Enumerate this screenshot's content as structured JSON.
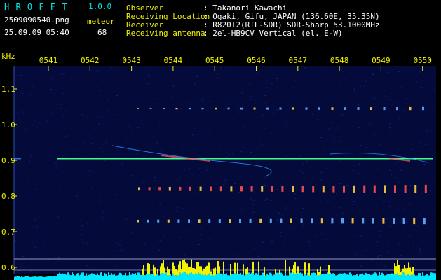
{
  "header": {
    "app_name": "H R O F F T",
    "version": "1.0.0",
    "filename": "2509090540.png",
    "datetime": "25.09.09 05:40",
    "meteor_label": "meteor",
    "meteor_count": "68",
    "info_labels": [
      "Observer",
      "Receiving Location",
      "Receiver",
      "Receiving antenna"
    ],
    "info_values": [
      ": Takanori Kawachi",
      ": Ogaki, Gifu, JAPAN (136.60E, 35.35N)",
      ": R820T2(RTL-SDR) SDR-Sharp 53.1000MHz",
      ": 2el-HB9CV Vertical (el. E-W)"
    ]
  },
  "spectrogram": {
    "y_unit": "kHz",
    "time_labels": [
      "0541",
      "0542",
      "0543",
      "0544",
      "0545",
      "0546",
      "0547",
      "0548",
      "0549",
      "0550"
    ],
    "freq_labels": [
      "1.1",
      "1.0",
      "0.9",
      "0.8",
      "0.7",
      "0.6"
    ],
    "freq_values": [
      1.1,
      1.0,
      0.9,
      0.8,
      0.7,
      0.6
    ],
    "carrier_khz": 0.905,
    "colors": {
      "label_cyan": "#00e5e5",
      "label_yellow": "#f0f000",
      "background": "#040a3a",
      "carrier": "#40ff90",
      "level_yellow": "#f2f200",
      "level_cyan": "#00e8ff"
    }
  }
}
